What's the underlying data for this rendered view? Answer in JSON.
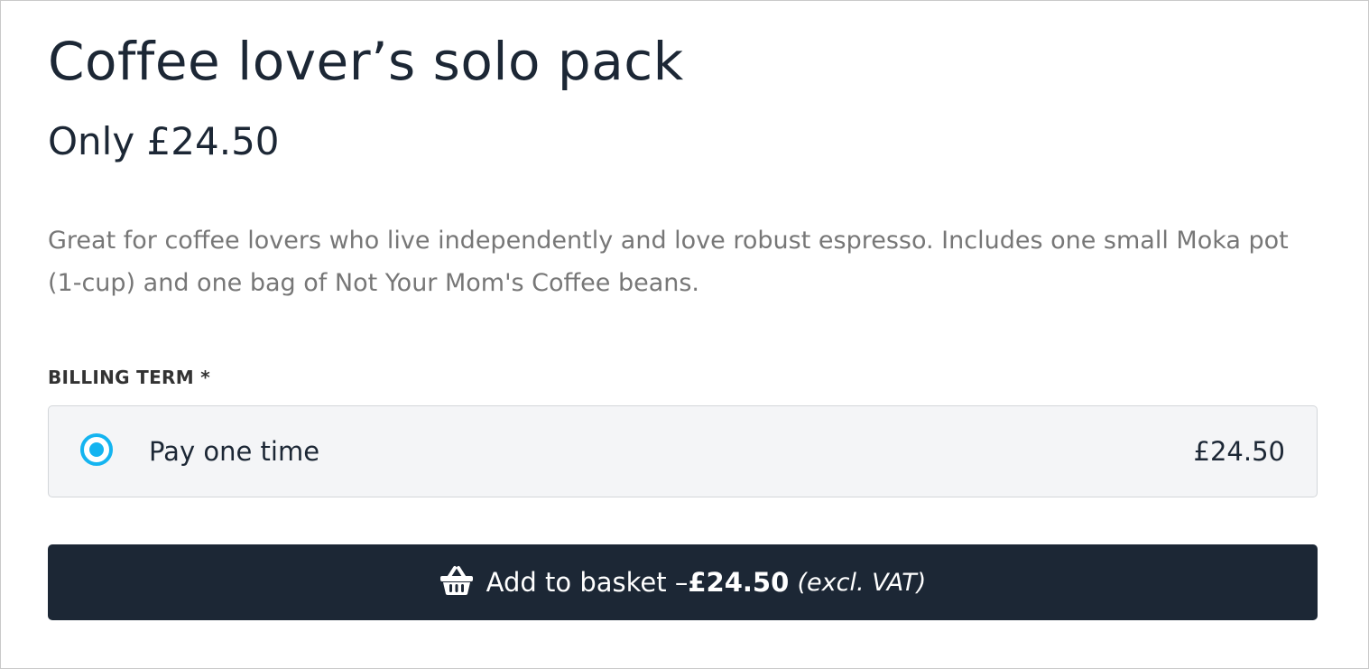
{
  "product": {
    "title": "Coffee lover’s solo pack",
    "price_line": "Only £24.50",
    "description": "Great for coffee lovers who live independently and love robust espresso. Includes one small Moka pot (1-cup) and one bag of Not Your Mom's Coffee beans."
  },
  "billing": {
    "label": "BILLING TERM *",
    "options": [
      {
        "label": "Pay one time",
        "price": "£24.50",
        "selected": true
      }
    ]
  },
  "add_button": {
    "icon": "basket-icon",
    "text": "Add to basket – ",
    "price": "£24.50",
    "vat_note": "(excl. VAT)"
  },
  "colors": {
    "primary": "#1c2735",
    "accent": "#14b4f0",
    "muted_text": "#777777",
    "option_background": "#f4f5f7"
  }
}
